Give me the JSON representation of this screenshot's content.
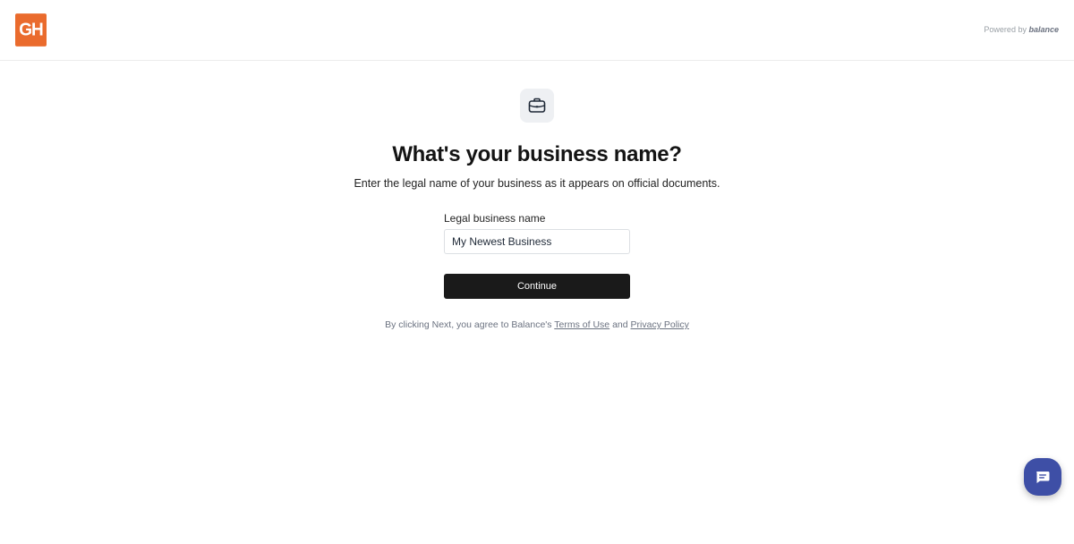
{
  "header": {
    "logo_text": "GH",
    "powered_prefix": "Powered by",
    "powered_brand": "balance"
  },
  "main": {
    "icon": "briefcase-icon",
    "title": "What's your business name?",
    "subtitle": "Enter the legal name of your business as it appears on official documents.",
    "field_label": "Legal business name",
    "field_value": "My Newest Business",
    "continue_label": "Continue",
    "legal_prefix": "By clicking Next, you agree to Balance's",
    "terms_label": "Terms of Use",
    "legal_and": "and",
    "privacy_label": "Privacy Policy"
  },
  "chat_widget": {
    "icon": "chat-bubble-icon"
  },
  "colors": {
    "logo_bg": "#ea6b2d",
    "button_bg": "#1a1a1a",
    "chat_bg": "#3e4fa6"
  }
}
